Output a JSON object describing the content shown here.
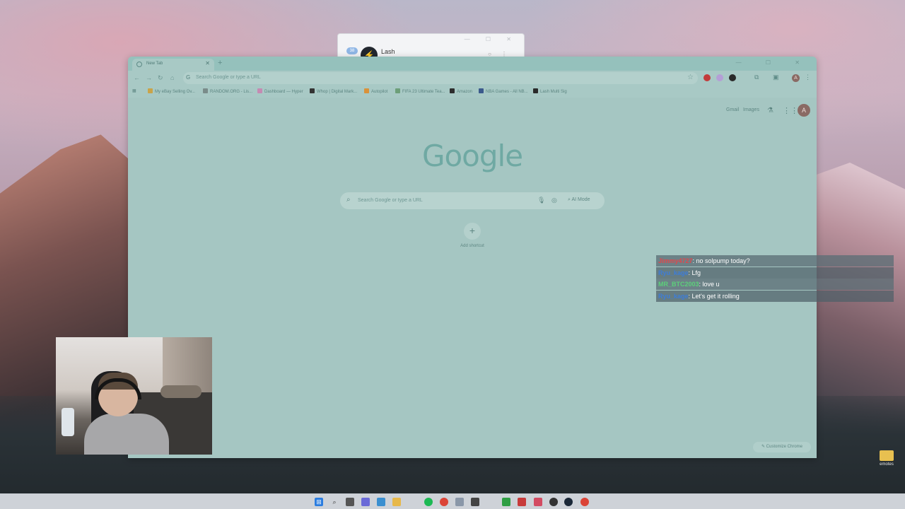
{
  "background_window": {
    "badge": "38",
    "title": "Lash"
  },
  "browser": {
    "tab": {
      "title": "New Tab"
    },
    "omnibox": {
      "placeholder": "Search Google or type a URL"
    },
    "bookmarks": [
      "My eBay Selling Ov...",
      "RANDOM.ORG - Lis...",
      "Dashboard — Hyper",
      "Whop | Digital Mark...",
      "Autopilot",
      "FIFA 23 Ultimate Tea...",
      "Amazon",
      "NBA Games - All NB...",
      "Lash Multi Sig"
    ],
    "profile_initial": "A",
    "ntp": {
      "gmail": "Gmail",
      "images": "Images",
      "logo": "Google",
      "search_placeholder": "Search Google or type a URL",
      "ai_mode": "AI Mode",
      "add_shortcut": "Add shortcut",
      "customize": "Customize Chrome"
    }
  },
  "chat": [
    {
      "user": "Jimmy4727",
      "message": ": no solpump today?",
      "color": "#e0474c"
    },
    {
      "user": "Ryu_kage",
      "message": ": Lfg",
      "color": "#3d7dd9"
    },
    {
      "user": "MR_BTC2003",
      "message": ": love u",
      "color": "#5cd07a"
    },
    {
      "user": "Ryu_kage",
      "message": ": Let's get it rolling",
      "color": "#3d7dd9"
    }
  ],
  "desktop": {
    "icon_label": "emotes"
  },
  "taskbar_icons": [
    "windows-start-icon",
    "search-icon",
    "file-explorer-icon",
    "chat-icon",
    "app-icon",
    "folder-icon",
    "spotify-icon",
    "chrome-icon",
    "settings-icon",
    "app-icon-2",
    "xbox-icon",
    "app-icon-3",
    "app-icon-4",
    "app-icon-5",
    "steam-icon",
    "chrome-icon-2"
  ]
}
